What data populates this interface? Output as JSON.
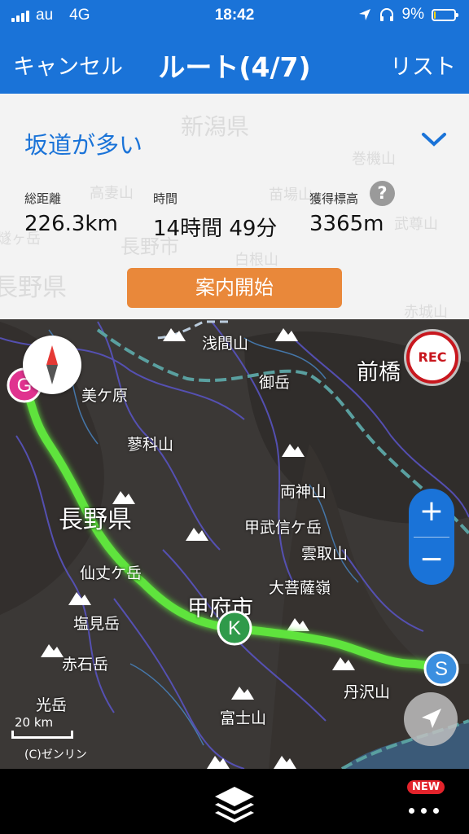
{
  "status_bar": {
    "carrier": "au",
    "network": "4G",
    "time": "18:42",
    "battery_percent": "9%",
    "battery_level": 0.09,
    "battery_color": "#ffd60a"
  },
  "navbar": {
    "cancel_label": "キャンセル",
    "title": "ルート(4/7)",
    "list_label": "リスト",
    "color": "#1a73d8"
  },
  "route_card": {
    "title": "坂道が多い",
    "stats": [
      {
        "label": "総距離",
        "value": "226.3km"
      },
      {
        "label": "時間",
        "value": "14時間 49分"
      },
      {
        "label": "獲得標高",
        "value": "3365m"
      }
    ],
    "help_icon": "?",
    "start_button": "案内開始",
    "start_button_color": "#e9883a"
  },
  "map": {
    "background_labels": [
      "新潟県",
      "巻機山",
      "高妻山",
      "苗場山",
      "燧ヶ岳",
      "長野市",
      "白根山",
      "武尊山",
      "長野県",
      "赤城山"
    ],
    "labels": {
      "asama": "浅間山",
      "maebashi": "前橋",
      "mikageno": "御岳",
      "utsukushigahara": "美ケ原",
      "tateshina": "蓼科山",
      "ryokami": "両神山",
      "nagano_pref": "長野県",
      "kobushi": "甲武信ケ岳",
      "kumotori": "雲取山",
      "senjo": "仙丈ケ岳",
      "daibosatsu": "大菩薩嶺",
      "kofu": "甲府市",
      "shiomi": "塩見岳",
      "akaishi": "赤石岳",
      "tanzawa": "丹沢山",
      "hijiri": "光岳",
      "fuji": "富士山"
    },
    "markers": {
      "start": "S",
      "goal": "G",
      "waypoint": "K"
    },
    "route_color": "#5ee33c",
    "scale_label": "20 km",
    "copyright": "(C)ゼンリン",
    "rec_label": "REC",
    "zoom_in": "+",
    "zoom_out": "−"
  },
  "bottom_bar": {
    "layers_icon": "layers-icon",
    "new_badge": "NEW",
    "more_icon": "more-icon"
  }
}
